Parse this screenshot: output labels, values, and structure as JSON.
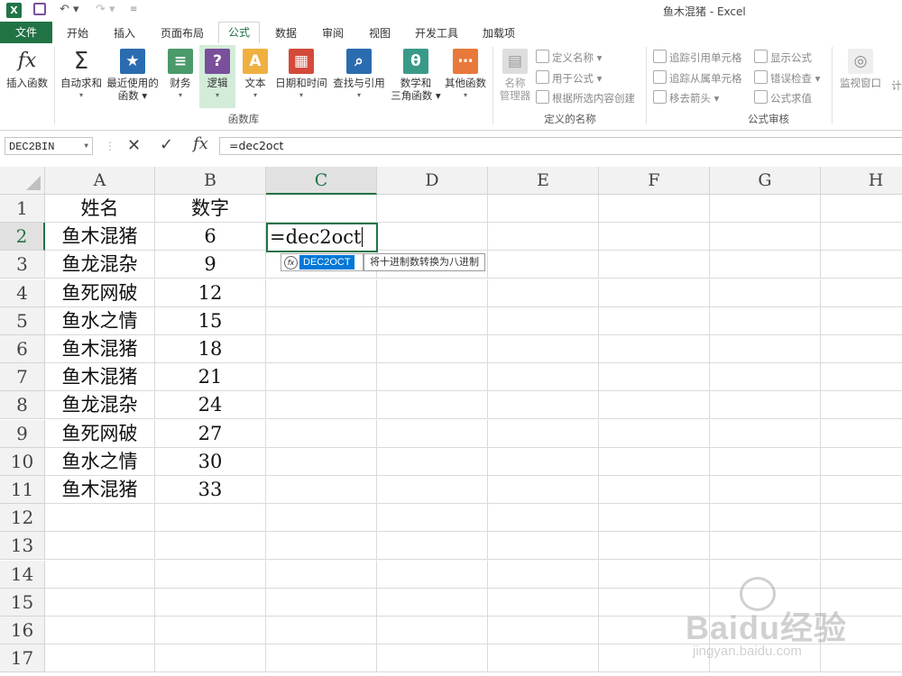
{
  "window": {
    "title": "鱼木混猪 - Excel"
  },
  "quick_access": {
    "excel_icon": "X",
    "save_icon": "save-icon",
    "undo_icon": "undo-icon",
    "redo_icon": "redo-icon"
  },
  "tabs": [
    "文件",
    "开始",
    "插入",
    "页面布局",
    "公式",
    "数据",
    "审阅",
    "视图",
    "开发工具",
    "加载项"
  ],
  "active_tab": "公式",
  "ribbon": {
    "insert_function": "插入函数",
    "autosum": "自动求和",
    "recent_line1": "最近使用的",
    "recent_line2": "函数",
    "financial": "财务",
    "logical": "逻辑",
    "text": "文本",
    "datetime": "日期和时间",
    "lookup": "查找与引用",
    "math_line1": "数学和",
    "math_line2": "三角函数",
    "more": "其他函数",
    "group_function_library": "函数库",
    "name_manager_line1": "名称",
    "name_manager_line2": "管理器",
    "define_name": "定义名称",
    "use_in_formula": "用于公式",
    "create_from_selection": "根据所选内容创建",
    "group_defined_names": "定义的名称",
    "trace_precedents": "追踪引用单元格",
    "trace_dependents": "追踪从属单元格",
    "remove_arrows": "移去箭头",
    "show_formulas": "显示公式",
    "error_checking": "错误检查",
    "evaluate_formula": "公式求值",
    "group_formula_auditing": "公式审核",
    "watch_window": "监视窗口",
    "calc_partial": "计"
  },
  "formula_bar": {
    "name_box": "DEC2BIN",
    "formula": "=dec2oct",
    "fx": "fx"
  },
  "columns": [
    "A",
    "B",
    "C",
    "D",
    "E",
    "F",
    "G",
    "H"
  ],
  "rows": [
    "1",
    "2",
    "3",
    "4",
    "5",
    "6",
    "7",
    "8",
    "9",
    "10",
    "11",
    "12",
    "13",
    "14",
    "15",
    "16",
    "17"
  ],
  "cells": {
    "header": {
      "A": "姓名",
      "B": "数字"
    },
    "data": [
      {
        "A": "鱼木混猪",
        "B": "6"
      },
      {
        "A": "鱼龙混杂",
        "B": "9"
      },
      {
        "A": "鱼死网破",
        "B": "12"
      },
      {
        "A": "鱼水之情",
        "B": "15"
      },
      {
        "A": "鱼木混猪",
        "B": "18"
      },
      {
        "A": "鱼木混猪",
        "B": "21"
      },
      {
        "A": "鱼龙混杂",
        "B": "24"
      },
      {
        "A": "鱼死网破",
        "B": "27"
      },
      {
        "A": "鱼水之情",
        "B": "30"
      },
      {
        "A": "鱼木混猪",
        "B": "33"
      }
    ]
  },
  "active_cell": {
    "ref": "C2",
    "value": "=dec2oct"
  },
  "autocomplete": {
    "item": "DEC2OCT",
    "tooltip": "将十进制数转换为八进制"
  },
  "watermark": {
    "line1": "Baidu经验",
    "line2": "jingyan.baidu.com"
  },
  "colors": {
    "accent": "#217346",
    "selection": "#0078d7"
  }
}
